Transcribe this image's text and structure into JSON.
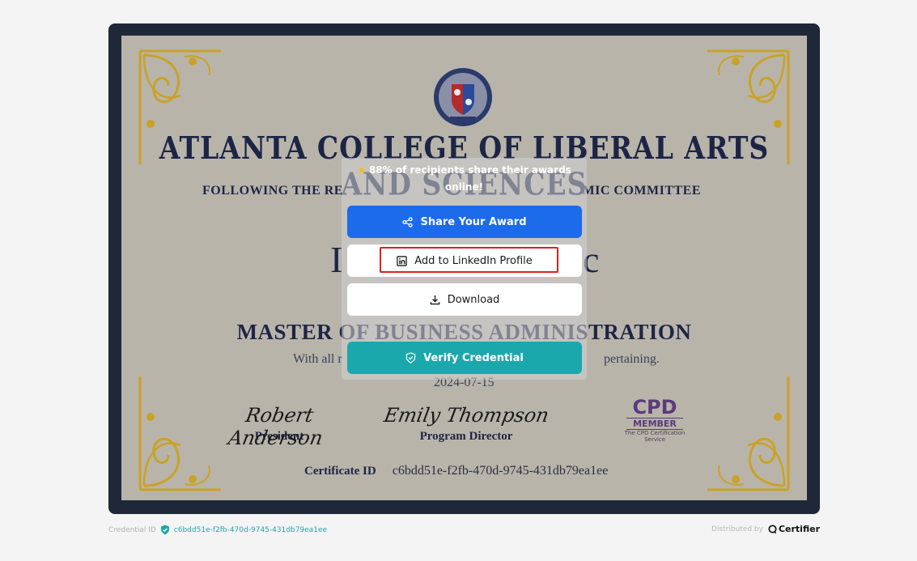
{
  "certificate": {
    "college_name": "ATLANTA COLLEGE OF LIBERAL ARTS AND SCIENCES",
    "following_left": "FOLLOWING THE RE",
    "following_right": "MIC COMMITTEE",
    "recipient_left": "I",
    "recipient_right": "c",
    "degree": "MASTER OF BUSINESS ADMINISTRATION",
    "with_all_left": "With all r",
    "with_all_right": "pertaining.",
    "date": "2024-07-15",
    "signatures": [
      {
        "script": "Robert Anderson",
        "role": "President"
      },
      {
        "script": "Emily Thompson",
        "role": "Program Director"
      }
    ],
    "cpd": {
      "mark": "CPD",
      "member": "MEMBER",
      "service": "The CPD Certification Service"
    },
    "id_label": "Certificate ID",
    "id_value": "c6bdd51e-f2fb-470d-9745-431db79ea1ee"
  },
  "overlay": {
    "hint": "88% of recipients share their awards online!",
    "share_label": "Share Your Award",
    "linkedin_label": "Add to LinkedIn Profile",
    "download_label": "Download",
    "verify_label": "Verify Credential"
  },
  "footer": {
    "credential_label": "Credential ID",
    "credential_value": "c6bdd51e-f2fb-470d-9745-431db79ea1ee",
    "distributed_label": "Distributed by",
    "brand": "Certifier"
  },
  "colors": {
    "share": "#1b6bea",
    "verify": "#1ba8ad",
    "highlight": "#e02020",
    "frame": "#1e2838",
    "gold": "#c9a227"
  },
  "icons": [
    "share-icon",
    "linkedin-icon",
    "download-icon",
    "shield-check-icon",
    "star-icon",
    "verified-badge-icon",
    "certifier-logo-icon"
  ]
}
